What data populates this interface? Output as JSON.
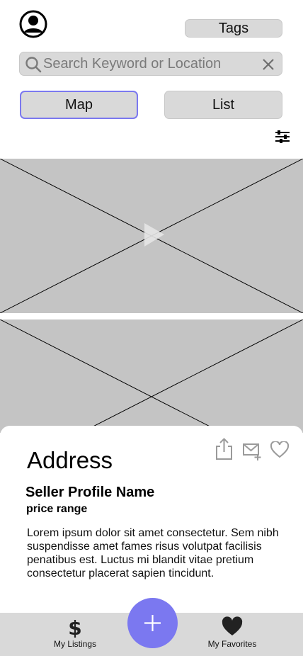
{
  "header": {
    "profile_icon": "user-circle-icon",
    "tags_label": "Tags"
  },
  "search": {
    "placeholder": "Search Keyword or Location",
    "value": "",
    "search_icon": "magnifier-icon",
    "clear_icon": "close-icon"
  },
  "view_toggle": {
    "options": [
      {
        "label": "Map",
        "selected": true
      },
      {
        "label": "List",
        "selected": false
      }
    ]
  },
  "filter_icon": "sliders-icon",
  "media": [
    {
      "kind": "video-placeholder",
      "icon": "play-icon"
    },
    {
      "kind": "image-placeholder"
    }
  ],
  "listing_card": {
    "address": "Address",
    "seller_name": "Seller Profile Name",
    "price_range": "price range",
    "description": "Lorem ipsum dolor sit amet consectetur. Sem nibh suspendisse amet fames risus volutpat facilisis penatibus est. Luctus mi blandit vitae pretium consectetur placerat sapien tincidunt.",
    "actions": [
      "share-icon",
      "mail-add-icon",
      "heart-outline-icon"
    ]
  },
  "bottom_nav": {
    "items": [
      {
        "label": "My Listings",
        "icon": "dollar-icon"
      },
      {
        "label": "My Favorites",
        "icon": "heart-filled-icon"
      }
    ],
    "fab_icon": "plus-icon"
  },
  "colors": {
    "accent": "#7b78f0",
    "control_bg": "#d9d9d9",
    "placeholder_bg": "#c4c4c4",
    "text": "#000000",
    "muted_text": "#7a7a7a"
  }
}
